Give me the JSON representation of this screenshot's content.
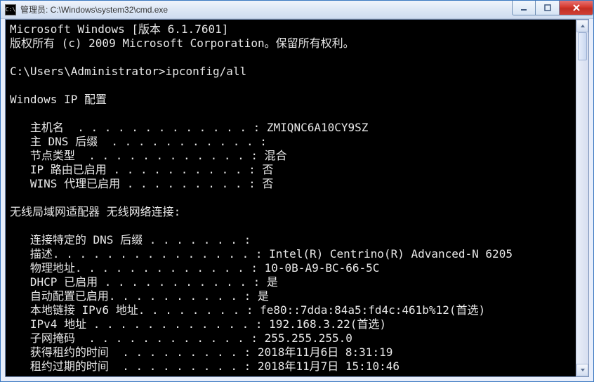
{
  "window": {
    "title": "管理员: C:\\Windows\\system32\\cmd.exe",
    "icon_label": "C:\\"
  },
  "console": {
    "line_version": "Microsoft Windows [版本 6.1.7601]",
    "line_copyright": "版权所有 (c) 2009 Microsoft Corporation。保留所有权利。",
    "prompt": "C:\\Users\\Administrator>",
    "command": "ipconfig/all",
    "section_ipconfig": "Windows IP 配置",
    "host": {
      "hostname_label": "主机名",
      "hostname_value": "ZMIQNC6A10CY9SZ",
      "primary_dns_suffix_label": "主 DNS 后缀",
      "primary_dns_suffix_value": "",
      "node_type_label": "节点类型",
      "node_type_value": "混合",
      "ip_routing_label": "IP 路由已启用",
      "ip_routing_value": "否",
      "wins_proxy_label": "WINS 代理已启用",
      "wins_proxy_value": "否"
    },
    "section_adapter": "无线局域网适配器 无线网络连接:",
    "adapter": {
      "conn_dns_suffix_label": "连接特定的 DNS 后缀",
      "conn_dns_suffix_value": "",
      "description_label": "描述",
      "description_value": "Intel(R) Centrino(R) Advanced-N 6205",
      "physical_addr_label": "物理地址",
      "physical_addr_value": "10-0B-A9-BC-66-5C",
      "dhcp_enabled_label": "DHCP 已启用",
      "dhcp_enabled_value": "是",
      "autoconfig_label": "自动配置已启用",
      "autoconfig_value": "是",
      "link_local_ipv6_label": "本地链接 IPv6 地址",
      "link_local_ipv6_value": "fe80::7dda:84a5:fd4c:461b%12(首选)",
      "ipv4_label": "IPv4 地址",
      "ipv4_value": "192.168.3.22(首选)",
      "subnet_label": "子网掩码",
      "subnet_value": "255.255.255.0",
      "lease_obtained_label": "获得租约的时间",
      "lease_obtained_value": "2018年11月6日 8:31:19",
      "lease_expires_label": "租约过期的时间",
      "lease_expires_value": "2018年11月7日 15:10:46"
    }
  }
}
